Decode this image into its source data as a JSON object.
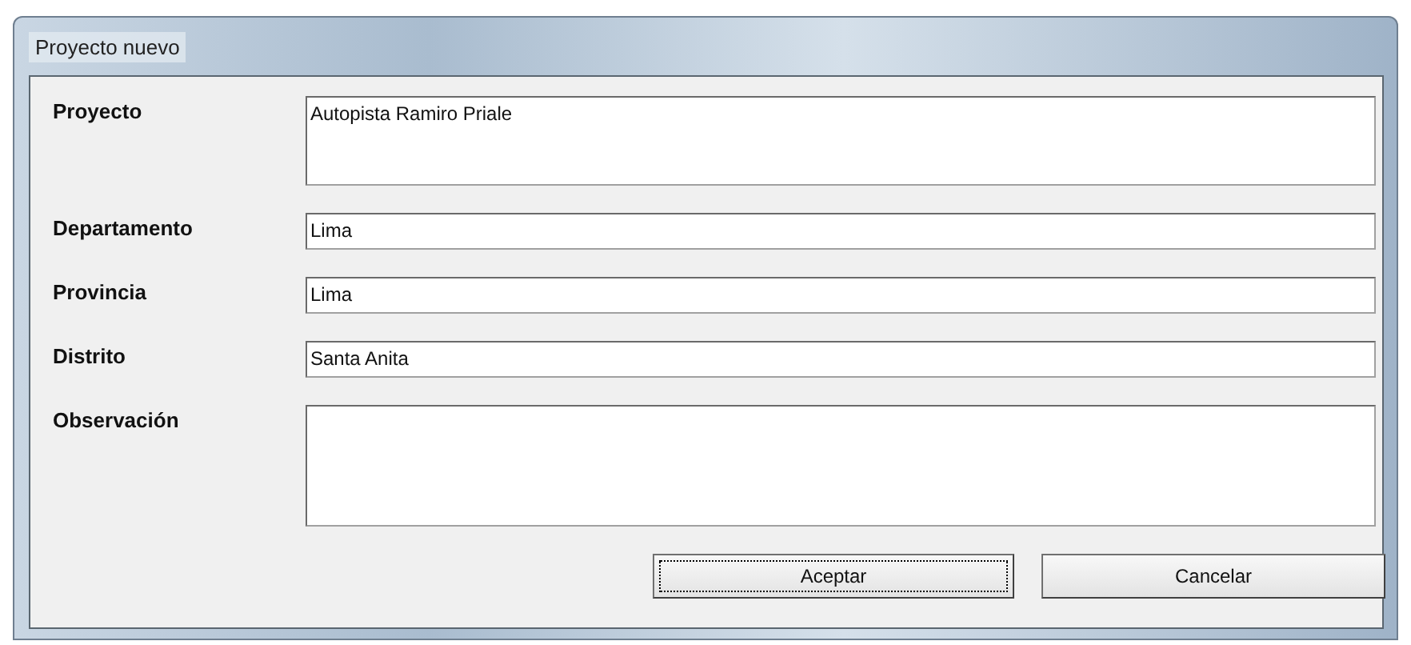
{
  "window": {
    "title": "Proyecto nuevo"
  },
  "fields": [
    {
      "label": "Proyecto",
      "value": "Autopista Ramiro Priale",
      "kind": "multiline"
    },
    {
      "label": "Departamento",
      "value": "Lima",
      "kind": "single"
    },
    {
      "label": "Provincia",
      "value": "Lima",
      "kind": "single"
    },
    {
      "label": "Distrito",
      "value": "Santa Anita",
      "kind": "single"
    },
    {
      "label": "Observación",
      "kind": "multiline"
    }
  ],
  "buttons": [
    {
      "label": "Aceptar",
      "focused": true
    },
    {
      "label": "Cancelar",
      "focused": false
    }
  ]
}
